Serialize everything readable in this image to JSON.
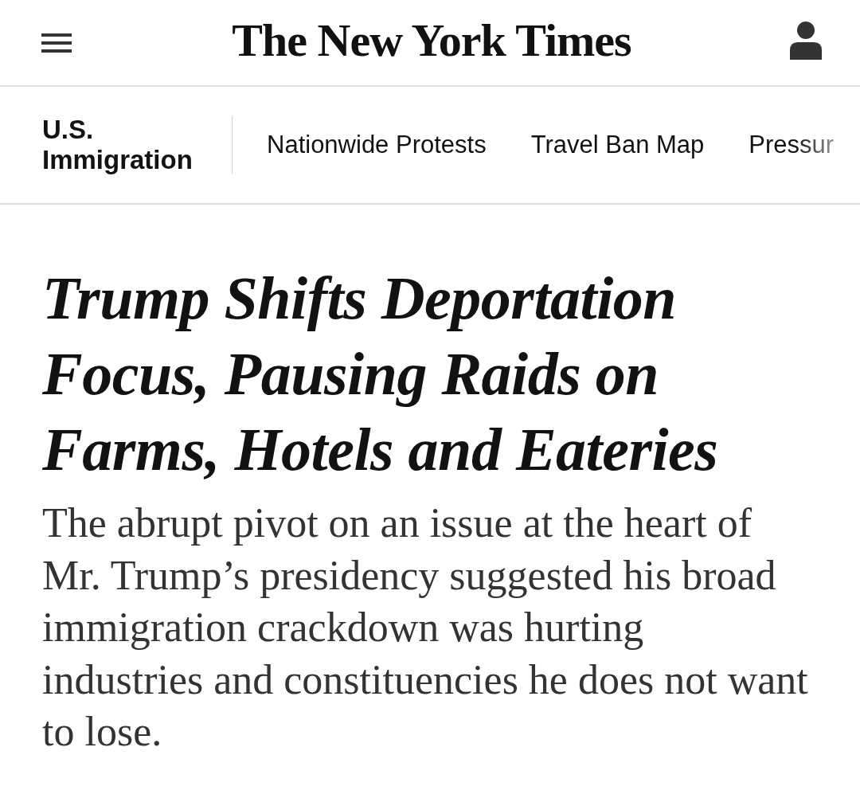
{
  "header": {
    "logo": "The New York Times"
  },
  "section_nav": {
    "section": "U.S. Immigration",
    "links": [
      "Nationwide Protests",
      "Travel Ban Map",
      "Pressur"
    ]
  },
  "article": {
    "headline": "Trump Shifts Deportation Focus, Pausing Raids on Farms, Hotels and Eateries",
    "summary": "The abrupt pivot on an issue at the heart of Mr. Trump’s presidency suggested his broad immigration crackdown was hurting industries and constituencies he does not want to lose."
  }
}
